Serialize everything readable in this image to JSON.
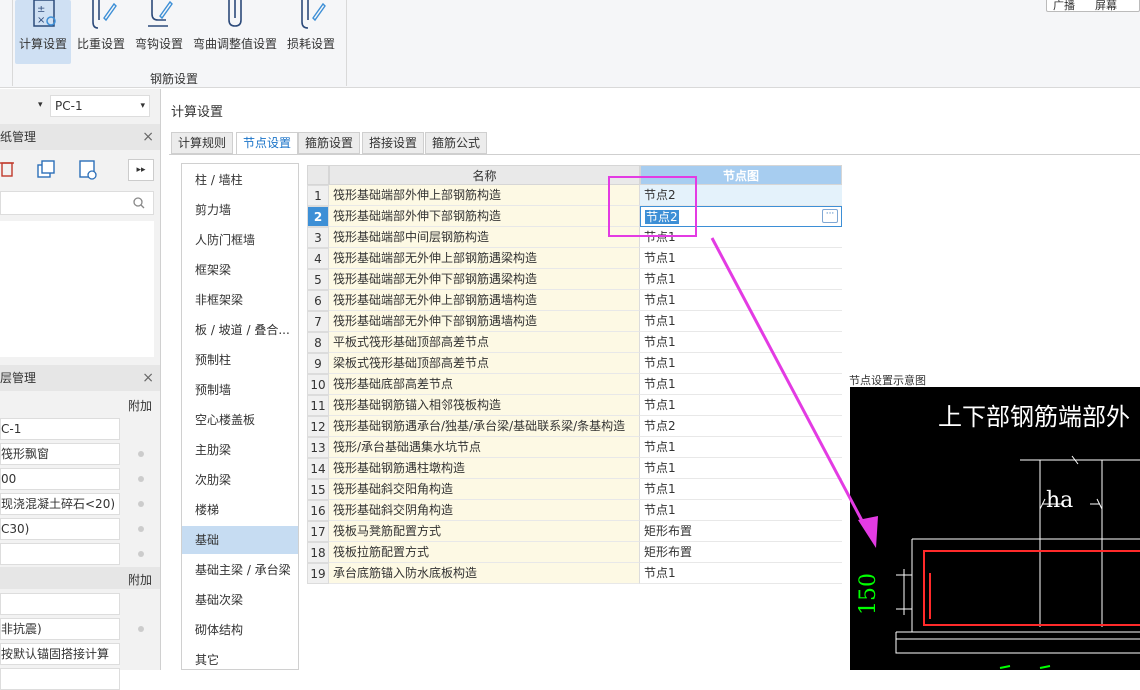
{
  "ribbon": {
    "buttons": [
      {
        "label": "计算设置",
        "icon": "calc-settings-icon"
      },
      {
        "label": "比重设置",
        "icon": "weight-settings-icon"
      },
      {
        "label": "弯钩设置",
        "icon": "hook-settings-icon"
      },
      {
        "label": "弯曲调整值设置",
        "icon": "bend-adjust-icon"
      },
      {
        "label": "损耗设置",
        "icon": "loss-settings-icon"
      }
    ],
    "group_label": "钢筋设置",
    "top_right": [
      "广播",
      "屏幕"
    ]
  },
  "left_panel": {
    "combo_left": "▾",
    "combo_right": "PC-1",
    "drawing_panel_title": "纸管理",
    "layer_panel_title": "层管理",
    "col_header": "附加",
    "layer_rows": [
      "C-1",
      "筏形飘窗",
      "00",
      "现浇混凝土碎石<20)",
      "C30)",
      ""
    ],
    "col_header2": "附加",
    "rows2": [
      "",
      "非抗震)",
      "按默认锚固搭接计算"
    ]
  },
  "dialog": {
    "title": "计算设置",
    "tabs": [
      "计算规则",
      "节点设置",
      "箍筋设置",
      "搭接设置",
      "箍筋公式"
    ],
    "categories": [
      "柱 / 墙柱",
      "剪力墙",
      "人防门框墙",
      "框架梁",
      "非框架梁",
      "板 / 坡道 / 叠合...",
      "预制柱",
      "预制墙",
      "空心楼盖板",
      "主肋梁",
      "次肋梁",
      "楼梯",
      "基础",
      "基础主梁 / 承台梁",
      "基础次梁",
      "砌体结构",
      "其它"
    ],
    "selected_category": "基础",
    "grid_headers": {
      "name": "名称",
      "node": "节点图"
    },
    "rows": [
      {
        "no": "1",
        "name": "筏形基础端部外伸上部钢筋构造",
        "value": "节点2"
      },
      {
        "no": "2",
        "name": "筏形基础端部外伸下部钢筋构造",
        "value": "节点2"
      },
      {
        "no": "3",
        "name": "筏形基础端部中间层钢筋构造",
        "value": "节点1"
      },
      {
        "no": "4",
        "name": "筏形基础端部无外伸上部钢筋遇梁构造",
        "value": "节点1"
      },
      {
        "no": "5",
        "name": "筏形基础端部无外伸下部钢筋遇梁构造",
        "value": "节点1"
      },
      {
        "no": "6",
        "name": "筏形基础端部无外伸上部钢筋遇墙构造",
        "value": "节点1"
      },
      {
        "no": "7",
        "name": "筏形基础端部无外伸下部钢筋遇墙构造",
        "value": "节点1"
      },
      {
        "no": "8",
        "name": "平板式筏形基础顶部高差节点",
        "value": "节点1"
      },
      {
        "no": "9",
        "name": "梁板式筏形基础顶部高差节点",
        "value": "节点1"
      },
      {
        "no": "10",
        "name": "筏形基础底部高差节点",
        "value": "节点1"
      },
      {
        "no": "11",
        "name": "筏形基础钢筋锚入相邻筏板构造",
        "value": "节点1"
      },
      {
        "no": "12",
        "name": "筏形基础钢筋遇承台/独基/承台梁/基础联系梁/条基构造",
        "value": "节点2"
      },
      {
        "no": "13",
        "name": "筏形/承台基础遇集水坑节点",
        "value": "节点1"
      },
      {
        "no": "14",
        "name": "筏形基础钢筋遇柱墩构造",
        "value": "节点1"
      },
      {
        "no": "15",
        "name": "筏形基础斜交阳角构造",
        "value": "节点1"
      },
      {
        "no": "16",
        "name": "筏形基础斜交阴角构造",
        "value": "节点1"
      },
      {
        "no": "17",
        "name": "筏板马凳筋配置方式",
        "value": "矩形布置"
      },
      {
        "no": "18",
        "name": "筏板拉筋配置方式",
        "value": "矩形布置"
      },
      {
        "no": "19",
        "name": "承台底筋锚入防水底板构造",
        "value": "节点1"
      }
    ],
    "ellipsis_label": "···",
    "diagram": {
      "label": "节点设置示意图",
      "title": "上下部钢筋端部外",
      "dim_ha": "ha",
      "dim_150": "150"
    }
  },
  "colors": {
    "accent": "#3d8fd6",
    "highlight": "#e33be3",
    "header_node": "#a7cdf0"
  }
}
